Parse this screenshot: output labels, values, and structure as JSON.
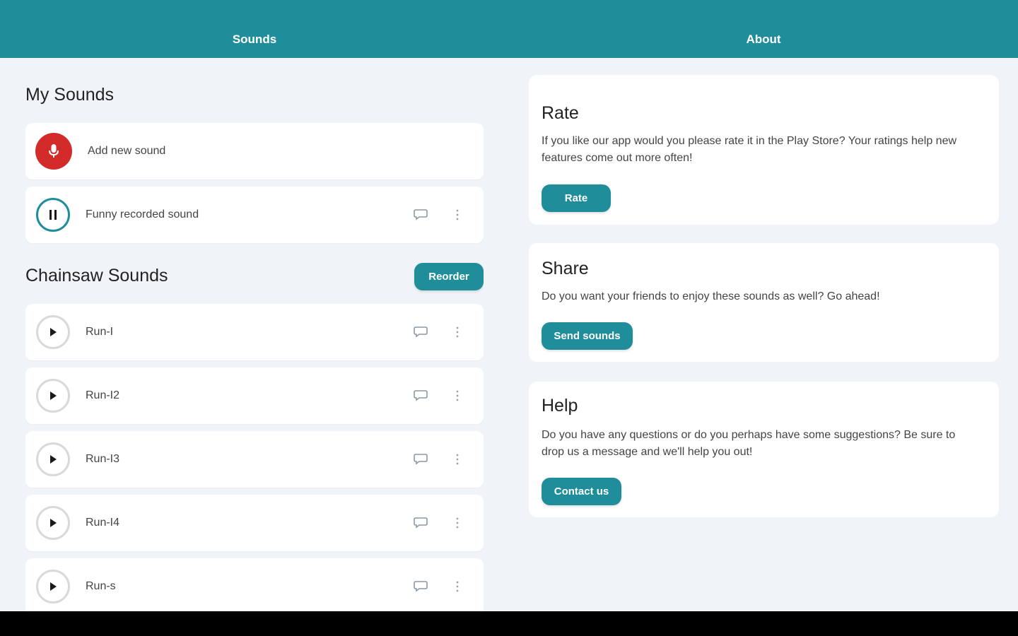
{
  "tabs": [
    {
      "label": "Sounds"
    },
    {
      "label": "About"
    }
  ],
  "my_sounds": {
    "title": "My Sounds",
    "add_label": "Add new sound",
    "recorded_label": "Funny recorded sound"
  },
  "chainsaw": {
    "title": "Chainsaw Sounds",
    "reorder_label": "Reorder",
    "items": [
      {
        "label": "Run-I"
      },
      {
        "label": "Run-I2"
      },
      {
        "label": "Run-I3"
      },
      {
        "label": "Run-I4"
      },
      {
        "label": "Run-s"
      }
    ]
  },
  "about": {
    "rate": {
      "title": "Rate",
      "text": "If you like our app would you please rate it in the Play Store? Your ratings help new features come out more often!",
      "button": "Rate"
    },
    "share": {
      "title": "Share",
      "text": "Do you want your friends to enjoy these sounds as well? Go ahead!",
      "button": "Send sounds"
    },
    "help": {
      "title": "Help",
      "text": "Do you have any questions or do you perhaps have some suggestions? Be sure to drop us a message and we'll help you out!",
      "button": "Contact us"
    }
  },
  "colors": {
    "accent": "#1f8e9a",
    "record": "#d32a2a",
    "background": "#f0f4f8"
  }
}
